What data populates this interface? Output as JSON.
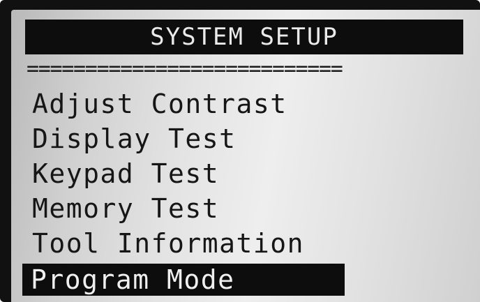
{
  "screen": {
    "title": "SYSTEM SETUP",
    "separator": "==========================="
  },
  "menu": {
    "items": [
      {
        "label": "Adjust Contrast",
        "selected": false
      },
      {
        "label": "Display Test",
        "selected": false
      },
      {
        "label": "Keypad Test",
        "selected": false
      },
      {
        "label": "Memory Test",
        "selected": false
      },
      {
        "label": "Tool Information",
        "selected": false
      },
      {
        "label": "Program Mode",
        "selected": true
      }
    ]
  },
  "colors": {
    "bezel": "#111111",
    "lcd_background": "#e4e4e4",
    "text": "#161616",
    "highlight": "#0d0d0d",
    "highlight_text": "#efefef"
  }
}
